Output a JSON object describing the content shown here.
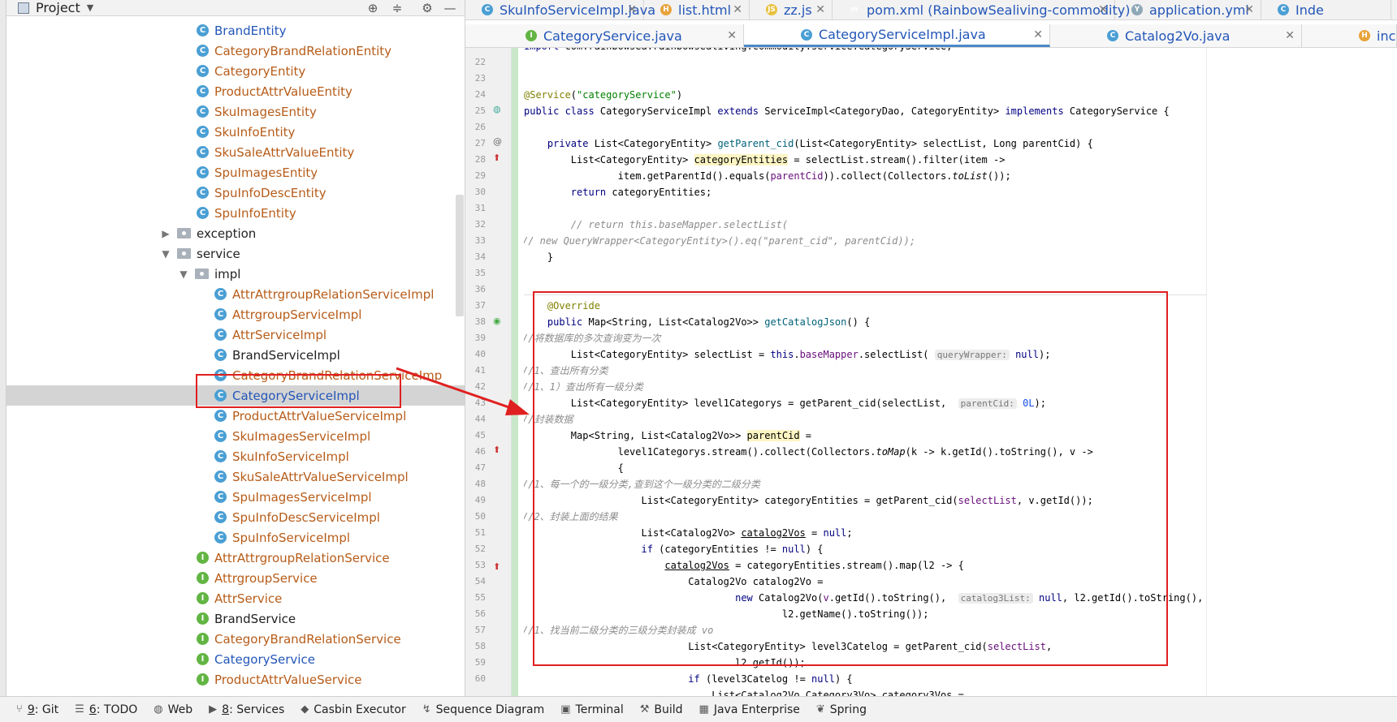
{
  "project_panel": {
    "title": "Project",
    "tree": [
      {
        "label": "BrandEntity",
        "kind": "class",
        "color": "blue",
        "indent": 3
      },
      {
        "label": "CategoryBrandRelationEntity",
        "kind": "class",
        "color": "orange",
        "indent": 3
      },
      {
        "label": "CategoryEntity",
        "kind": "class",
        "color": "orange",
        "indent": 3
      },
      {
        "label": "ProductAttrValueEntity",
        "kind": "class",
        "color": "orange",
        "indent": 3
      },
      {
        "label": "SkuImagesEntity",
        "kind": "class",
        "color": "orange",
        "indent": 3
      },
      {
        "label": "SkuInfoEntity",
        "kind": "class",
        "color": "orange",
        "indent": 3
      },
      {
        "label": "SkuSaleAttrValueEntity",
        "kind": "class",
        "color": "orange",
        "indent": 3
      },
      {
        "label": "SpuImagesEntity",
        "kind": "class",
        "color": "orange",
        "indent": 3
      },
      {
        "label": "SpuInfoDescEntity",
        "kind": "class",
        "color": "orange",
        "indent": 3
      },
      {
        "label": "SpuInfoEntity",
        "kind": "class",
        "color": "orange",
        "indent": 3
      },
      {
        "label": "exception",
        "kind": "folder",
        "color": "dark",
        "indent": 2,
        "arrow": "▶"
      },
      {
        "label": "service",
        "kind": "folder",
        "color": "dark",
        "indent": 2,
        "arrow": "▼"
      },
      {
        "label": "impl",
        "kind": "folder",
        "color": "dark",
        "indent": 3,
        "arrow": "▼"
      },
      {
        "label": "AttrAttrgroupRelationServiceImpl",
        "kind": "class",
        "color": "orange",
        "indent": 4
      },
      {
        "label": "AttrgroupServiceImpl",
        "kind": "class",
        "color": "orange",
        "indent": 4
      },
      {
        "label": "AttrServiceImpl",
        "kind": "class",
        "color": "orange",
        "indent": 4
      },
      {
        "label": "BrandServiceImpl",
        "kind": "class",
        "color": "dark",
        "indent": 4
      },
      {
        "label": "CategoryBrandRelationServiceImp",
        "kind": "class",
        "color": "orange",
        "indent": 4
      },
      {
        "label": "CategoryServiceImpl",
        "kind": "class",
        "color": "blue",
        "indent": 4,
        "selected": true
      },
      {
        "label": "ProductAttrValueServiceImpl",
        "kind": "class",
        "color": "orange",
        "indent": 4
      },
      {
        "label": "SkuImagesServiceImpl",
        "kind": "class",
        "color": "orange",
        "indent": 4
      },
      {
        "label": "SkuInfoServiceImpl",
        "kind": "class",
        "color": "orange",
        "indent": 4
      },
      {
        "label": "SkuSaleAttrValueServiceImpl",
        "kind": "class",
        "color": "orange",
        "indent": 4
      },
      {
        "label": "SpuImagesServiceImpl",
        "kind": "class",
        "color": "orange",
        "indent": 4
      },
      {
        "label": "SpuInfoDescServiceImpl",
        "kind": "class",
        "color": "orange",
        "indent": 4
      },
      {
        "label": "SpuInfoServiceImpl",
        "kind": "class",
        "color": "orange",
        "indent": 4
      },
      {
        "label": "AttrAttrgroupRelationService",
        "kind": "interface",
        "color": "orange",
        "indent": 3
      },
      {
        "label": "AttrgroupService",
        "kind": "interface",
        "color": "orange",
        "indent": 3
      },
      {
        "label": "AttrService",
        "kind": "interface",
        "color": "orange",
        "indent": 3
      },
      {
        "label": "BrandService",
        "kind": "interface",
        "color": "dark",
        "indent": 3
      },
      {
        "label": "CategoryBrandRelationService",
        "kind": "interface",
        "color": "orange",
        "indent": 3
      },
      {
        "label": "CategoryService",
        "kind": "interface",
        "color": "blue",
        "indent": 3
      },
      {
        "label": "ProductAttrValueService",
        "kind": "interface",
        "color": "orange",
        "indent": 3
      }
    ]
  },
  "tabs_row1": [
    {
      "label": "SkuInfoServiceImpl.java",
      "icon": "c"
    },
    {
      "label": "list.html",
      "icon": "html"
    },
    {
      "label": "zz.js",
      "icon": "js"
    },
    {
      "label": "pom.xml (RainbowSealiving-commodity)",
      "icon": "m"
    },
    {
      "label": "application.yml",
      "icon": "yml"
    },
    {
      "label": "Inde",
      "icon": "c"
    }
  ],
  "tabs_row2": [
    {
      "label": "CategoryService.java",
      "icon": "i"
    },
    {
      "label": "CategoryServiceImpl.java",
      "icon": "c",
      "active": true
    },
    {
      "label": "Catalog2Vo.java",
      "icon": "c"
    },
    {
      "label": "inc",
      "icon": "html"
    }
  ],
  "editor": {
    "line_numbers": [
      "22",
      "23",
      "24",
      "25",
      "26",
      "27",
      "28",
      "29",
      "30",
      "31",
      "32",
      "33",
      "34",
      "35",
      "36",
      "37",
      "38",
      "39",
      "40",
      "41",
      "42",
      "43",
      "44",
      "45",
      "46",
      "47",
      "48",
      "49",
      "50",
      "51",
      "52",
      "53",
      "54",
      "55",
      "56",
      "57",
      "58",
      "59",
      "60"
    ]
  },
  "bottombar": [
    {
      "key": "9",
      "label": ": Git",
      "icon": "git-icon"
    },
    {
      "key": "6",
      "label": ": TODO",
      "icon": "todo-icon"
    },
    {
      "key": "",
      "label": "Web",
      "icon": "web-icon"
    },
    {
      "key": "8",
      "label": ": Services",
      "icon": "services-icon"
    },
    {
      "key": "",
      "label": "Casbin Executor",
      "icon": "casbin-icon"
    },
    {
      "key": "",
      "label": "Sequence Diagram",
      "icon": "sequence-icon"
    },
    {
      "key": "",
      "label": "Terminal",
      "icon": "terminal-icon"
    },
    {
      "key": "",
      "label": "Build",
      "icon": "build-icon"
    },
    {
      "key": "",
      "label": "Java Enterprise",
      "icon": "java-enterprise-icon"
    },
    {
      "key": "",
      "label": "Spring",
      "icon": "spring-icon"
    }
  ],
  "colors": {
    "annotation_red": "#e02020",
    "selection": "#d4d4d4",
    "accent": "#4a88c7"
  }
}
